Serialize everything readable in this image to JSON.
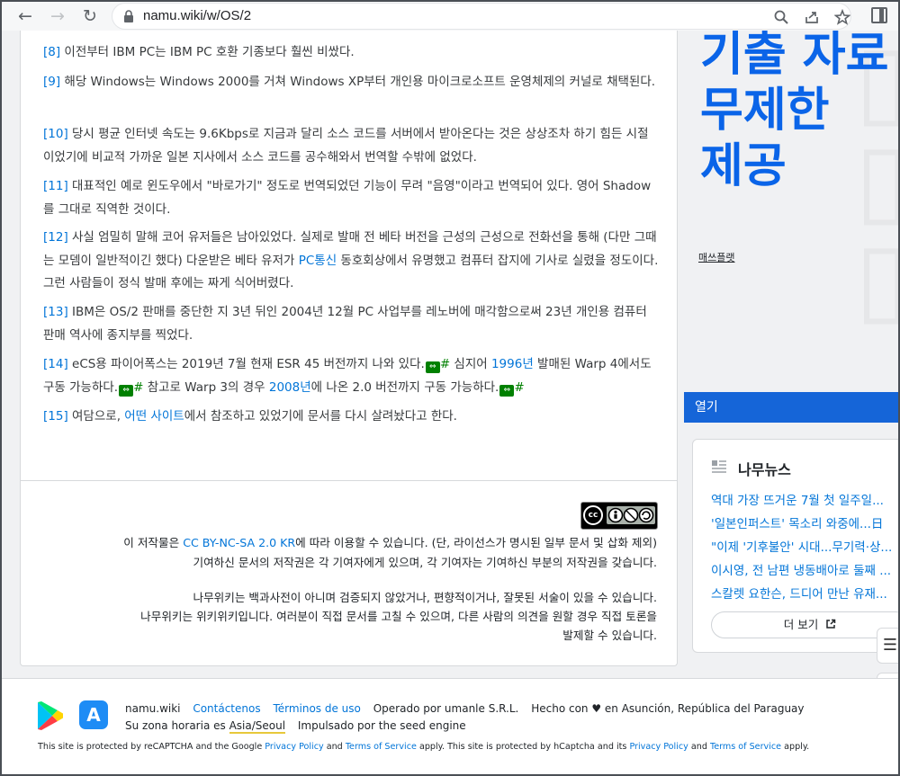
{
  "browser": {
    "url": "namu.wiki/w/OS/2"
  },
  "footnotes": [
    {
      "num": "[8]",
      "text": " 이전부터 IBM PC는 IBM PC 호환 기종보다 훨씬 비쌌다."
    },
    {
      "num": "[9]",
      "text": " 해당 Windows는 Windows 2000를 거쳐 Windows XP부터 개인용 마이크로소프트 운영체제의 커널로 채택된다."
    },
    {
      "num": "[10]",
      "text": " 당시 평균 인터넷 속도는 9.6Kbps로 지금과 달리 소스 코드를 서버에서 받아온다는 것은 상상조차 하기 힘든 시절이었기에 비교적 가까운 일본 지사에서 소스 코드를 공수해와서 번역할 수밖에 없었다."
    },
    {
      "num": "[11]",
      "text": " 대표적인 예로 윈도우에서 \"바로가기\" 정도로 번역되었던 기능이 무려 \"음영\"이라고 번역되어 있다. 영어 Shadow를 그대로 직역한 것이다."
    },
    {
      "num": "[12]",
      "pre": " 사실 엄밀히 말해 코어 유저들은 남아있었다. 실제로 발매 전 베타 버전을 근성의 근성으로 전화선을 통해 (다만 그때는 모뎀이 일반적이긴 했다) 다운받은 베타 유저가 ",
      "link": "PC통신",
      "post": " 동호회상에서 유명했고 컴퓨터 잡지에 기사로 실렸을 정도이다. 그런 사람들이 정식 발매 후에는 짜게 식어버렸다."
    },
    {
      "num": "[13]",
      "text": " IBM은 OS/2 판매를 중단한 지 3년 뒤인 2004년 12월 PC 사업부를 레노버에 매각함으로써 23년 개인용 컴퓨터 판매 역사에 종지부를 찍었다."
    },
    {
      "num": "[14]",
      "a": " eCS용 파이어폭스는 2019년 7월 현재 ESR 45 버전까지 나와 있다.",
      "b": " 심지어 ",
      "link1": "1996년",
      "c": " 발매된 Warp 4에서도 구동 가능하다.",
      "d": " 참고로 Warp 3의 경우 ",
      "link2": "2008년",
      "e": "에 나온 2.0 버전까지 구동 가능하다.",
      "hash": "#",
      "ext": "⇔"
    },
    {
      "num": "[15]",
      "pre": " 여담으로, ",
      "link": "어떤 사이트",
      "post": "에서 참조하고 있었기에 문서를 다시 살려놨다고 한다."
    }
  ],
  "license": {
    "cc_text": "cc",
    "line1_pre": "이 저작물은 ",
    "line1_link": "CC BY-NC-SA 2.0 KR",
    "line1_post": "에 따라 이용할 수 있습니다. (단, 라이선스가 명시된 일부 문서 및 삽화 제외)",
    "line2": "기여하신 문서의 저작권은 각 기여자에게 있으며, 각 기여자는 기여하신 부분의 저작권을 갖습니다.",
    "line3": "나무위키는 백과사전이 아니며 검증되지 않았거나, 편향적이거나, 잘못된 서술이 있을 수 있습니다.",
    "line4": "나무위키는 위키위키입니다. 여러분이 직접 문서를 고칠 수 있으며, 다른 사람의 의견을 원할 경우 직접 토론을",
    "line5": "발제할 수 있습니다."
  },
  "sidebar": {
    "ad_headline": [
      "기출 자료",
      "무제한",
      "제공"
    ],
    "ad_sponsor": "매쓰플랫",
    "open_label": "열기",
    "news_title": "나무뉴스",
    "news_items": [
      "역대 가장 뜨거운 7월 첫 일주일...",
      "'일본인퍼스트' 목소리 와중에...日",
      "\"이제 '기후불안' 시대...무기력·상...",
      "이시영, 전 남편 냉동배아로 둘째 ...",
      "스칼렛 요한슨, 드디어 만난 유재..."
    ],
    "more_label": "더 보기"
  },
  "footer": {
    "site": "namu.wiki",
    "contact": "Contáctenos",
    "terms": "Términos de uso",
    "operator": "Operado por umanle S.R.L.",
    "made": "Hecho con ♥ en Asunción, República del Paraguay",
    "tz_pre": "Su zona horaria es ",
    "tz": "Asia/Seoul",
    "engine": "Impulsado por the seed engine",
    "rc1": "This site is protected by reCAPTCHA and the Google ",
    "pp": "Privacy Policy",
    "and": " and ",
    "tos": "Terms of Service",
    "rc2": " apply. This site is protected by hCaptcha and its ",
    "rc3": " apply."
  },
  "icons": {
    "back": "←",
    "forward": "→",
    "reload": "↻",
    "zoom": "🔍",
    "share": "⇪",
    "star": "☆",
    "toc": "☰",
    "up": "↑",
    "down": "↓",
    "external": "⇗"
  },
  "colors": {
    "link": "#0275d8",
    "accent": "#1565d8",
    "ad_text": "#0a64e8",
    "ext_link": "#008000"
  }
}
